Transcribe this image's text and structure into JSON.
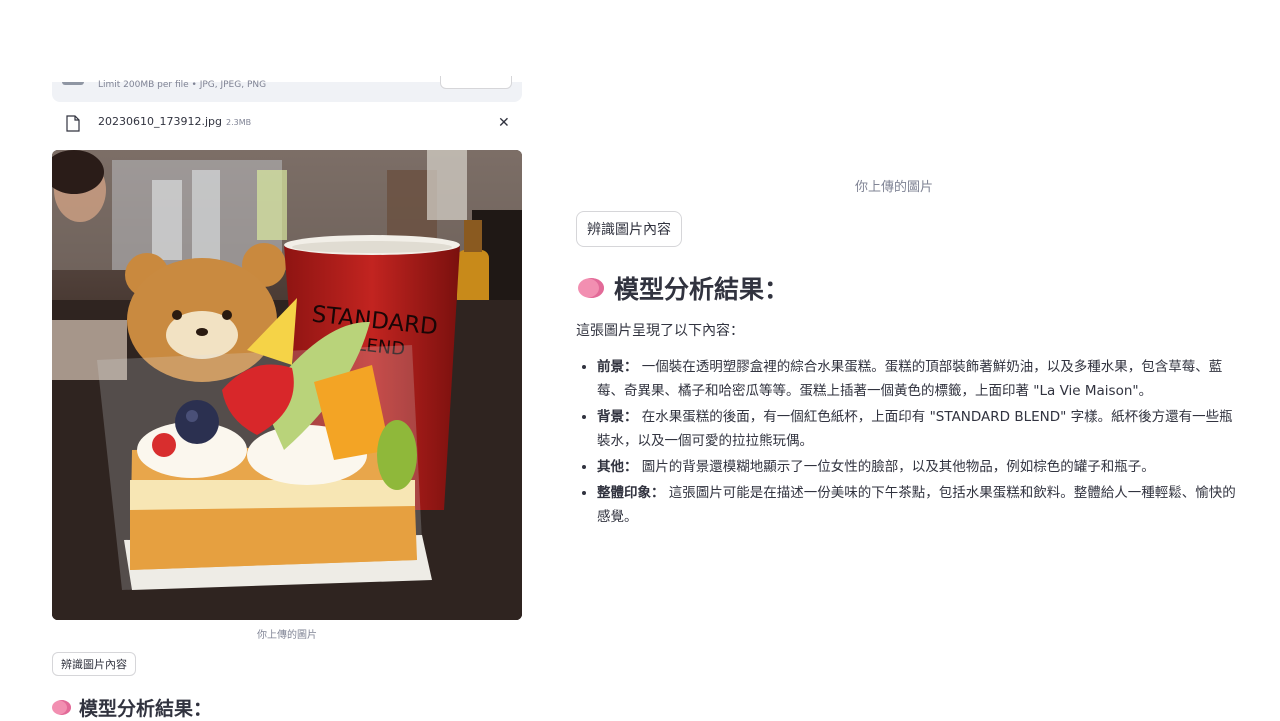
{
  "uploader": {
    "limit_text": "Limit 200MB per file • JPG, JPEG, PNG",
    "file_name": "20230610_173912.jpg",
    "file_size": "2.3MB",
    "remove_icon": "close-icon"
  },
  "left": {
    "caption": "你上傳的圖片",
    "button": "辨識圖片內容",
    "heading": "模型分析結果："
  },
  "right": {
    "caption": "你上傳的圖片",
    "button": "辨識圖片內容",
    "heading": "模型分析結果：",
    "intro": "這張圖片呈現了以下內容：",
    "items": [
      {
        "label": "前景：",
        "text": "一個裝在透明塑膠盒裡的綜合水果蛋糕。蛋糕的頂部裝飾著鮮奶油，以及多種水果，包含草莓、藍莓、奇異果、橘子和哈密瓜等等。蛋糕上插著一個黃色的標籤，上面印著 \"La Vie Maison\"。"
      },
      {
        "label": "背景：",
        "text": "在水果蛋糕的後面，有一個紅色紙杯，上面印有 \"STANDARD BLEND\" 字樣。紙杯後方還有一些瓶裝水，以及一個可愛的拉拉熊玩偶。"
      },
      {
        "label": "其他：",
        "text": "圖片的背景還模糊地顯示了一位女性的臉部，以及其他物品，例如棕色的罐子和瓶子。"
      },
      {
        "label": "整體印象：",
        "text": "這張圖片可能是在描述一份美味的下午茶點，包括水果蛋糕和飲料。整體給人一種輕鬆、愉快的感覺。"
      }
    ]
  },
  "photo": {
    "cup_text_1": "STANDARD",
    "cup_text_2": "BLEND"
  },
  "colors": {
    "accent_brain": "#f28fb1",
    "text": "#31333f",
    "muted": "#808495"
  }
}
